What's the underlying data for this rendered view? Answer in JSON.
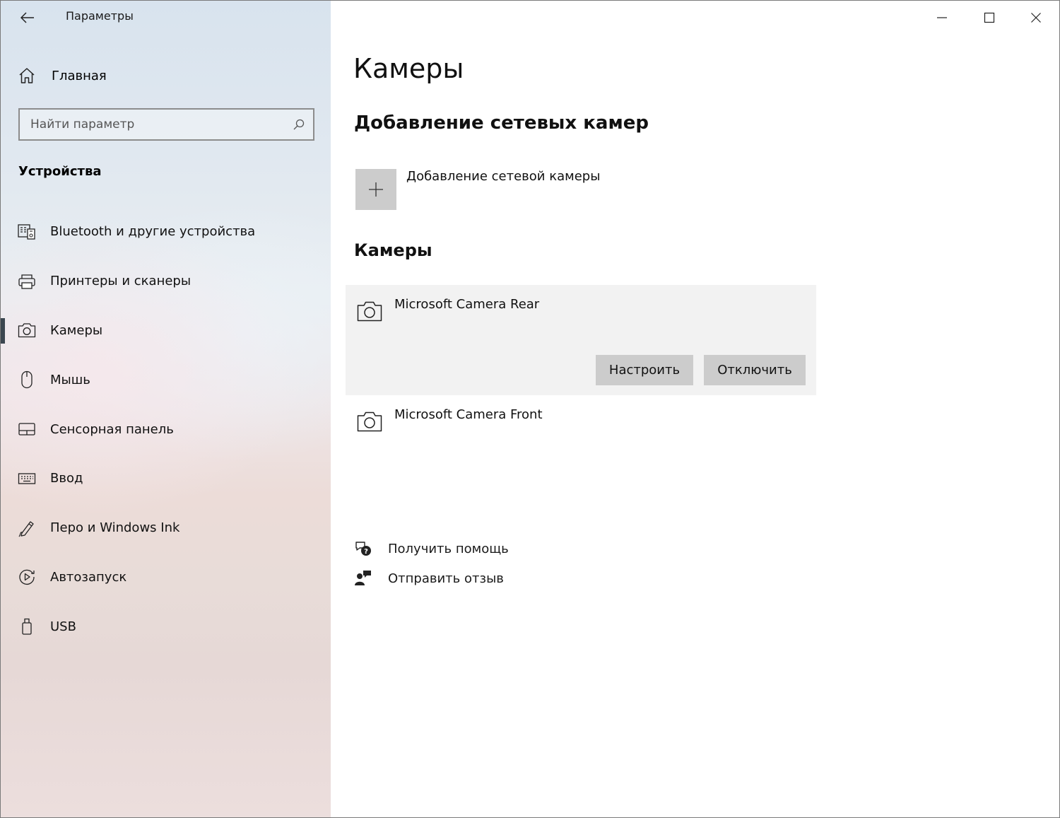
{
  "window": {
    "title": "Параметры"
  },
  "sidebar": {
    "home_label": "Главная",
    "search_placeholder": "Найти параметр",
    "section_title": "Устройства",
    "items": [
      {
        "label": "Bluetooth и другие устройства",
        "icon": "bluetooth-devices-icon",
        "active": false
      },
      {
        "label": "Принтеры и сканеры",
        "icon": "printer-icon",
        "active": false
      },
      {
        "label": "Камеры",
        "icon": "camera-icon",
        "active": true
      },
      {
        "label": "Мышь",
        "icon": "mouse-icon",
        "active": false
      },
      {
        "label": "Сенсорная панель",
        "icon": "touchpad-icon",
        "active": false
      },
      {
        "label": "Ввод",
        "icon": "keyboard-icon",
        "active": false
      },
      {
        "label": "Перо и Windows Ink",
        "icon": "pen-icon",
        "active": false
      },
      {
        "label": "Автозапуск",
        "icon": "autoplay-icon",
        "active": false
      },
      {
        "label": "USB",
        "icon": "usb-icon",
        "active": false
      }
    ]
  },
  "main": {
    "title": "Камеры",
    "network_section_title": "Добавление сетевых камер",
    "add_network_camera_label": "Добавление сетевой камеры",
    "cameras_section_title": "Камеры",
    "cameras": [
      {
        "name": "Microsoft Camera Rear",
        "selected": true
      },
      {
        "name": "Microsoft Camera Front",
        "selected": false
      }
    ],
    "configure_label": "Настроить",
    "disable_label": "Отключить",
    "help_link": "Получить помощь",
    "feedback_link": "Отправить отзыв"
  }
}
